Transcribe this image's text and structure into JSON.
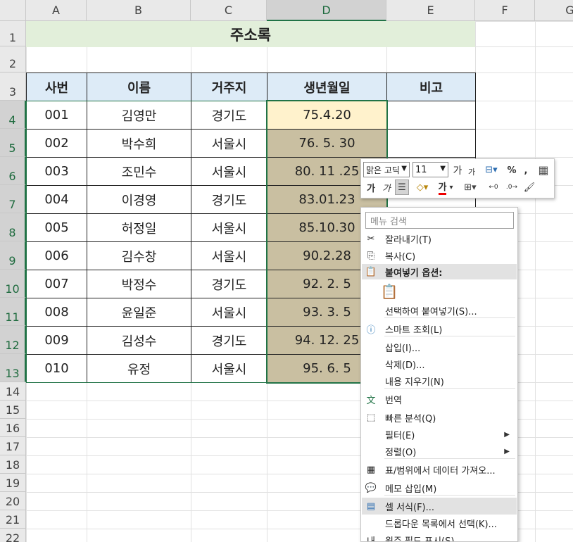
{
  "columns": [
    "A",
    "B",
    "C",
    "D",
    "E",
    "F",
    "G"
  ],
  "rows": [
    "1",
    "2",
    "3",
    "4",
    "5",
    "6",
    "7",
    "8",
    "9",
    "10",
    "11",
    "12",
    "13",
    "14",
    "15",
    "16",
    "17",
    "18",
    "19",
    "20",
    "21",
    "22"
  ],
  "title": "주소록",
  "headers": [
    "사번",
    "이름",
    "거주지",
    "생년월일",
    "비고"
  ],
  "records": [
    {
      "id": "001",
      "name": "김영만",
      "addr": "경기도",
      "birth": "75.4.20"
    },
    {
      "id": "002",
      "name": "박수희",
      "addr": "서울시",
      "birth": "76. 5. 30"
    },
    {
      "id": "003",
      "name": "조민수",
      "addr": "서울시",
      "birth": "80. 11 .25"
    },
    {
      "id": "004",
      "name": "이경영",
      "addr": "경기도",
      "birth": "83.01.23"
    },
    {
      "id": "005",
      "name": "허정일",
      "addr": "서울시",
      "birth": "85.10.30"
    },
    {
      "id": "006",
      "name": "김수창",
      "addr": "서울시",
      "birth": "90.2.28"
    },
    {
      "id": "007",
      "name": "박정수",
      "addr": "경기도",
      "birth": "92. 2. 5"
    },
    {
      "id": "008",
      "name": "윤일준",
      "addr": "서울시",
      "birth": "93.  3. 5"
    },
    {
      "id": "009",
      "name": "김성수",
      "addr": "경기도",
      "birth": "94. 12. 25"
    },
    {
      "id": "010",
      "name": "유정",
      "addr": "서울시",
      "birth": "95. 6. 5"
    }
  ],
  "mini_toolbar": {
    "font_name": "맑은 고딕",
    "font_size": "11",
    "grow_font": "가",
    "shrink_font": "가",
    "percent": "%",
    "comma": ",",
    "bold": "가",
    "italic": "가",
    "font_color_glyph": "가"
  },
  "context_menu": {
    "search_placeholder": "메뉴 검색",
    "items": [
      {
        "label": "잘라내기(T)",
        "icon": "scissors-icon"
      },
      {
        "label": "복사(C)",
        "icon": "copy-icon"
      },
      {
        "label": "붙여넣기 옵션:",
        "icon": "paste-icon"
      },
      {
        "label": "",
        "icon": "paste-clipboard-icon"
      },
      {
        "label": "선택하여 붙여넣기(S)...",
        "icon": ""
      },
      {
        "label": "스마트 조회(L)",
        "icon": "smart-lookup-icon"
      },
      {
        "label": "삽입(I)...",
        "icon": ""
      },
      {
        "label": "삭제(D)...",
        "icon": ""
      },
      {
        "label": "내용 지우기(N)",
        "icon": ""
      },
      {
        "label": "번역",
        "icon": "translate-icon"
      },
      {
        "label": "빠른 분석(Q)",
        "icon": "quick-analysis-icon"
      },
      {
        "label": "필터(E)",
        "icon": ""
      },
      {
        "label": "정렬(O)",
        "icon": ""
      },
      {
        "label": "표/범위에서 데이터 가져오...",
        "icon": "table-icon"
      },
      {
        "label": "메모 삽입(M)",
        "icon": "comment-icon"
      },
      {
        "label": "셀 서식(F)...",
        "icon": "format-cells-icon"
      },
      {
        "label": "드롭다운 목록에서 선택(K)...",
        "icon": ""
      },
      {
        "label": "윗주 필드 표시(S)",
        "icon": "phonetic-icon"
      }
    ]
  },
  "colors": {
    "header_fill": "#ddebf7",
    "title_fill": "#e2efda",
    "selection_fill": "#c9bfa1",
    "active_cell": "#fff2cc",
    "accent": "#217346"
  }
}
